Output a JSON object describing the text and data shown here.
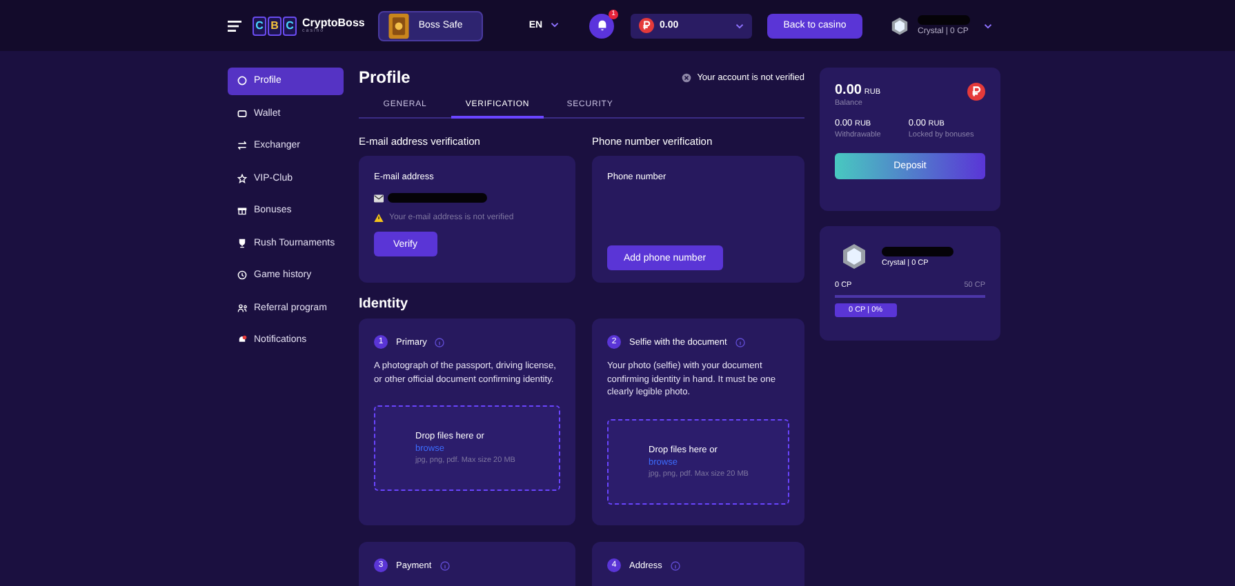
{
  "header": {
    "logo_letters": [
      "C",
      "B",
      "C"
    ],
    "logo_name": "CryptoBoss",
    "logo_sub": "casino",
    "promo": "Boss Safe",
    "language": "EN",
    "notification_count": "1",
    "balance": "0.00",
    "back_button": "Back to casino",
    "user_level": "Crystal | 0 CP"
  },
  "sidebar": {
    "items": [
      {
        "label": "Profile",
        "selected": true
      },
      {
        "label": "Wallet",
        "selected": false
      },
      {
        "label": "Exchanger",
        "selected": false
      },
      {
        "label": "VIP-Club",
        "selected": false
      },
      {
        "label": "Bonuses",
        "selected": false
      },
      {
        "label": "Rush Tournaments",
        "selected": false
      },
      {
        "label": "Game history",
        "selected": false
      },
      {
        "label": "Referral program",
        "selected": false
      },
      {
        "label": "Notifications",
        "selected": false
      }
    ]
  },
  "profile": {
    "title": "Profile",
    "account_status": "Your account is not verified",
    "tabs": [
      {
        "label": "GENERAL",
        "selected": false
      },
      {
        "label": "VERIFICATION",
        "selected": true
      },
      {
        "label": "SECURITY",
        "selected": false
      }
    ],
    "email": {
      "heading": "E-mail address verification",
      "label": "E-mail address",
      "warning": "Your e-mail address is not verified",
      "button": "Verify"
    },
    "phone": {
      "heading": "Phone number verification",
      "label": "Phone number",
      "button": "Add phone number"
    },
    "identity": {
      "heading": "Identity",
      "cards": [
        {
          "number": "1",
          "title": "Primary",
          "description": "A photograph of the passport, driving license, or other official document confirming identity.",
          "drop_text": "Drop files here or",
          "drop_link": "browse",
          "drop_hint": "jpg, png, pdf. Max size 20 MB"
        },
        {
          "number": "2",
          "title": "Selfie with the document",
          "description": "Your photo (selfie) with your document confirming identity in hand. It must be one clearly legible photo.",
          "drop_text": "Drop files here or",
          "drop_link": "browse",
          "drop_hint": "jpg, png, pdf. Max size 20 MB"
        },
        {
          "number": "3",
          "title": "Payment"
        },
        {
          "number": "4",
          "title": "Address"
        }
      ]
    }
  },
  "balance_card": {
    "amount": "0.00",
    "currency": "RUB",
    "label": "Balance",
    "items": [
      {
        "amount": "0.00",
        "currency": "RUB",
        "label": "Withdrawable"
      },
      {
        "amount": "0.00",
        "currency": "RUB",
        "label": "Locked by bonuses"
      }
    ],
    "button": "Deposit"
  },
  "level_card": {
    "rank": "Crystal | 0 CP",
    "min": "0 CP",
    "max": "50 CP",
    "badge": "0 CP | 0%"
  }
}
